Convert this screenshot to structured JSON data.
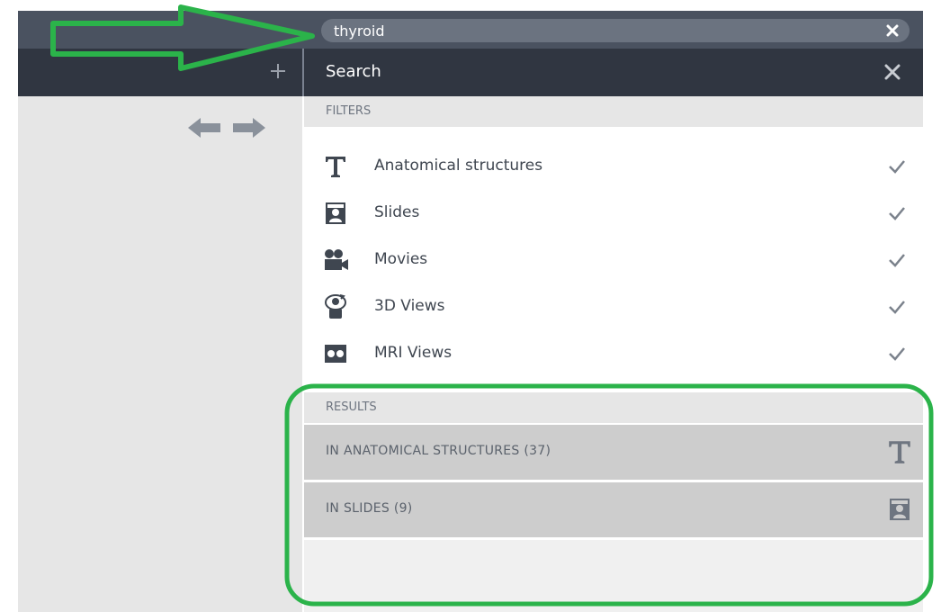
{
  "search": {
    "value": "thyroid",
    "clear_icon": "clear-icon"
  },
  "panel": {
    "title": "Search",
    "close_icon": "close-icon"
  },
  "filters": {
    "label": "FILTERS",
    "items": [
      {
        "label": "Anatomical structures",
        "icon": "text-t-icon",
        "checked": true
      },
      {
        "label": "Slides",
        "icon": "slides-icon",
        "checked": true
      },
      {
        "label": "Movies",
        "icon": "movie-camera-icon",
        "checked": true
      },
      {
        "label": "3D Views",
        "icon": "rotate-3d-icon",
        "checked": true
      },
      {
        "label": "MRI Views",
        "icon": "mri-icon",
        "checked": true
      }
    ]
  },
  "results": {
    "label": "RESULTS",
    "items": [
      {
        "label": "IN ANATOMICAL STRUCTURES (37)",
        "icon": "text-t-icon"
      },
      {
        "label": "IN SLIDES (9)",
        "icon": "slides-icon"
      }
    ]
  },
  "toolbar": {
    "add_icon": "plus-icon",
    "back_icon": "arrow-left-icon",
    "forward_icon": "arrow-right-icon"
  },
  "colors": {
    "dark_header": "#303641",
    "search_bar": "#4a5260",
    "annotation_green": "#2bb34a",
    "panel_gray": "#e6e6e6",
    "result_gray": "#cdcdcd"
  }
}
